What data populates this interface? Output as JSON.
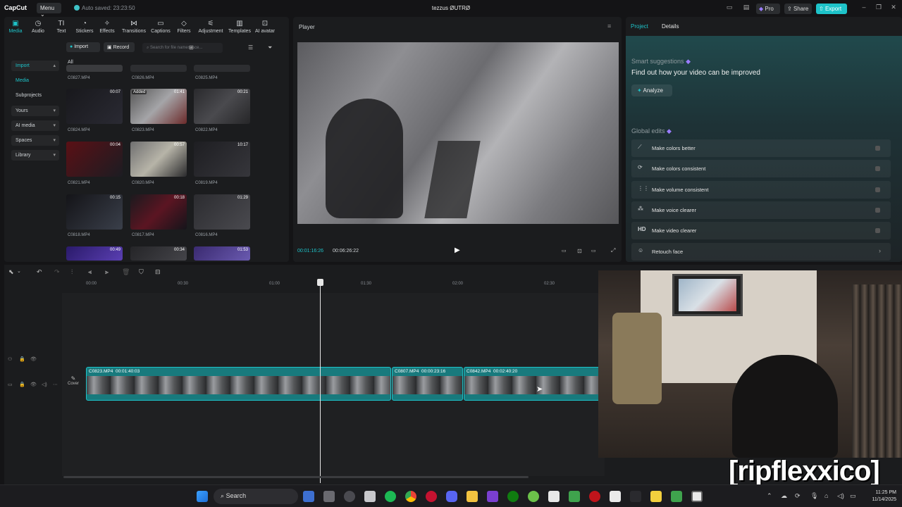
{
  "window": {
    "logo": "CapCut",
    "menu_label": "Menu",
    "autosave": "Auto saved: 23:23:50",
    "title": "tezzus ØUTRØ",
    "pro_label": "Pro",
    "share_label": "Share",
    "export_label": "Export",
    "accent": "#1ec3c9"
  },
  "tools": [
    {
      "label": "Media",
      "icon": "media-icon"
    },
    {
      "label": "Audio",
      "icon": "audio-icon"
    },
    {
      "label": "Text",
      "icon": "text-icon"
    },
    {
      "label": "Stickers",
      "icon": "stickers-icon"
    },
    {
      "label": "Effects",
      "icon": "effects-icon"
    },
    {
      "label": "Transitions",
      "icon": "transitions-icon"
    },
    {
      "label": "Captions",
      "icon": "captions-icon"
    },
    {
      "label": "Filters",
      "icon": "filters-icon"
    },
    {
      "label": "Adjustment",
      "icon": "adjustment-icon"
    },
    {
      "label": "Templates",
      "icon": "templates-icon"
    },
    {
      "label": "AI avatar",
      "icon": "ai-avatar-icon"
    }
  ],
  "side_nav": [
    {
      "label": "Import"
    },
    {
      "label": "Media"
    },
    {
      "label": "Subprojects"
    },
    {
      "label": "Yours"
    },
    {
      "label": "AI media"
    },
    {
      "label": "Spaces"
    },
    {
      "label": "Library"
    }
  ],
  "media_toolbar": {
    "import_label": "Import",
    "record_label": "Record",
    "search_placeholder": "Search for file names, sce..."
  },
  "media": {
    "filter_label": "All",
    "clips": [
      {
        "name": "C0827.MP4",
        "duration": "",
        "tag": ""
      },
      {
        "name": "C0826.MP4",
        "duration": "",
        "tag": ""
      },
      {
        "name": "C0825.MP4",
        "duration": "",
        "tag": ""
      },
      {
        "name": "C0824.MP4",
        "duration": "00:07",
        "tag": ""
      },
      {
        "name": "C0823.MP4",
        "duration": "01:41",
        "tag": "Added"
      },
      {
        "name": "C0822.MP4",
        "duration": "00:21",
        "tag": ""
      },
      {
        "name": "C0821.MP4",
        "duration": "00:04",
        "tag": ""
      },
      {
        "name": "C0820.MP4",
        "duration": "00:57",
        "tag": ""
      },
      {
        "name": "C0819.MP4",
        "duration": "10:17",
        "tag": ""
      },
      {
        "name": "C0818.MP4",
        "duration": "00:15",
        "tag": ""
      },
      {
        "name": "C0817.MP4",
        "duration": "00:18",
        "tag": ""
      },
      {
        "name": "C0816.MP4",
        "duration": "01:29",
        "tag": ""
      },
      {
        "name": "",
        "duration": "00:49",
        "tag": ""
      },
      {
        "name": "",
        "duration": "00:34",
        "tag": ""
      },
      {
        "name": "",
        "duration": "01:53",
        "tag": ""
      }
    ]
  },
  "player": {
    "label": "Player",
    "current_time": "00:01:16:26",
    "total_time": "00:06:26:22"
  },
  "right_panel": {
    "tab_project": "Project",
    "tab_details": "Details",
    "smart_title": "Smart suggestions",
    "smart_subtitle": "Find out how your video can be improved",
    "analyze_label": "Analyze",
    "global_title": "Global edits",
    "edits": [
      {
        "label": "Make colors better",
        "icon": "magic-wand-icon"
      },
      {
        "label": "Make colors consistent",
        "icon": "color-sync-icon"
      },
      {
        "label": "Make volume consistent",
        "icon": "volume-sliders-icon"
      },
      {
        "label": "Make voice clearer",
        "icon": "voice-wave-icon"
      },
      {
        "label": "Make video clearer",
        "icon": "hd-icon"
      },
      {
        "label": "Retouch face",
        "icon": "face-icon"
      }
    ]
  },
  "timeline": {
    "ticks": [
      "00:00",
      "00:30",
      "01:00",
      "01:30",
      "02:00",
      "02:30"
    ],
    "cover_label": "Cover",
    "segments": [
      {
        "name": "C0823.MP4",
        "duration": "00:01:40:03"
      },
      {
        "name": "C0807.MP4",
        "duration": "00:00:23:16"
      },
      {
        "name": "C0842.MP4",
        "duration": "00:02:40:20"
      }
    ]
  },
  "overlay": {
    "watermark": "[ripflexxico]"
  },
  "taskbar": {
    "search_label": "Search",
    "time": "11:25 PM",
    "date": "11/14/2025"
  }
}
